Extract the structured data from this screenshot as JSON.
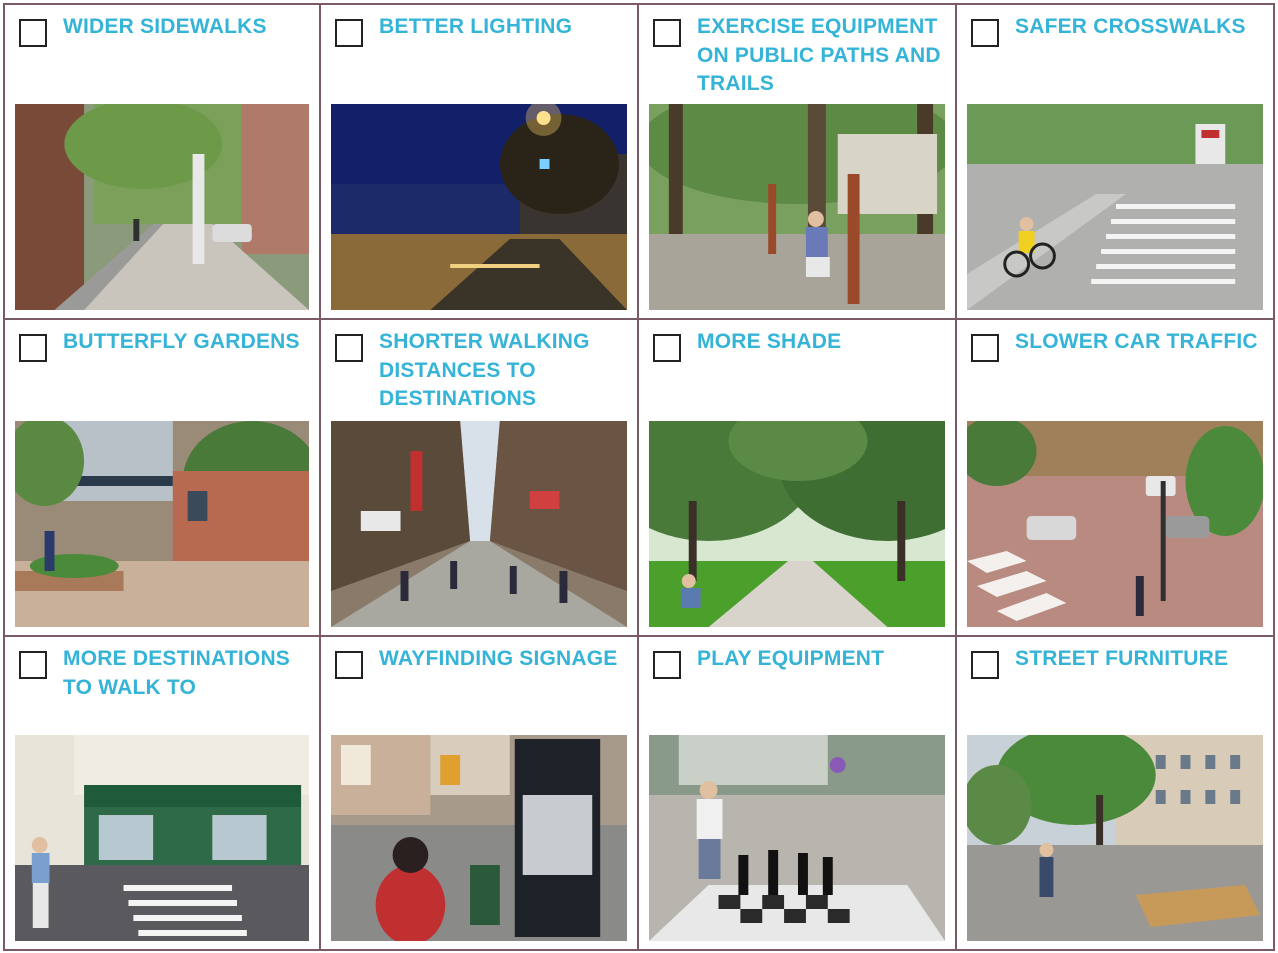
{
  "options": [
    {
      "label": "WIDER SIDEWALKS",
      "checked": false,
      "photo": "wide-sidewalk-street-photo"
    },
    {
      "label": "BETTER LIGHTING",
      "checked": false,
      "photo": "night-street-lighting-photo"
    },
    {
      "label": "EXERCISE EQUIPMENT ON PUBLIC PATHS AND TRAILS",
      "checked": false,
      "photo": "park-exercise-equipment-photo"
    },
    {
      "label": "SAFER CROSSWALKS",
      "checked": false,
      "photo": "bike-lane-crosswalk-photo"
    },
    {
      "label": "BUTTERFLY GARDENS",
      "checked": false,
      "photo": "pedestrian-street-garden-photo"
    },
    {
      "label": "SHORTER WALKING DISTANCES TO DESTINATIONS",
      "checked": false,
      "photo": "busy-shopping-street-photo"
    },
    {
      "label": "MORE SHADE",
      "checked": false,
      "photo": "tree-canopy-path-photo"
    },
    {
      "label": "SLOWER CAR TRAFFIC",
      "checked": false,
      "photo": "shared-street-plaza-photo"
    },
    {
      "label": "MORE DESTINATIONS TO WALK TO",
      "checked": false,
      "photo": "corner-shop-crosswalk-photo"
    },
    {
      "label": "WAYFINDING SIGNAGE",
      "checked": false,
      "photo": "street-map-sign-photo"
    },
    {
      "label": "PLAY EQUIPMENT",
      "checked": false,
      "photo": "giant-chess-plaza-photo"
    },
    {
      "label": "STREET FURNITURE",
      "checked": false,
      "photo": "plaza-bench-trees-photo"
    }
  ],
  "colors": {
    "label": "#35b4d8",
    "border": "#7a5a63",
    "checkbox": "#222222"
  }
}
